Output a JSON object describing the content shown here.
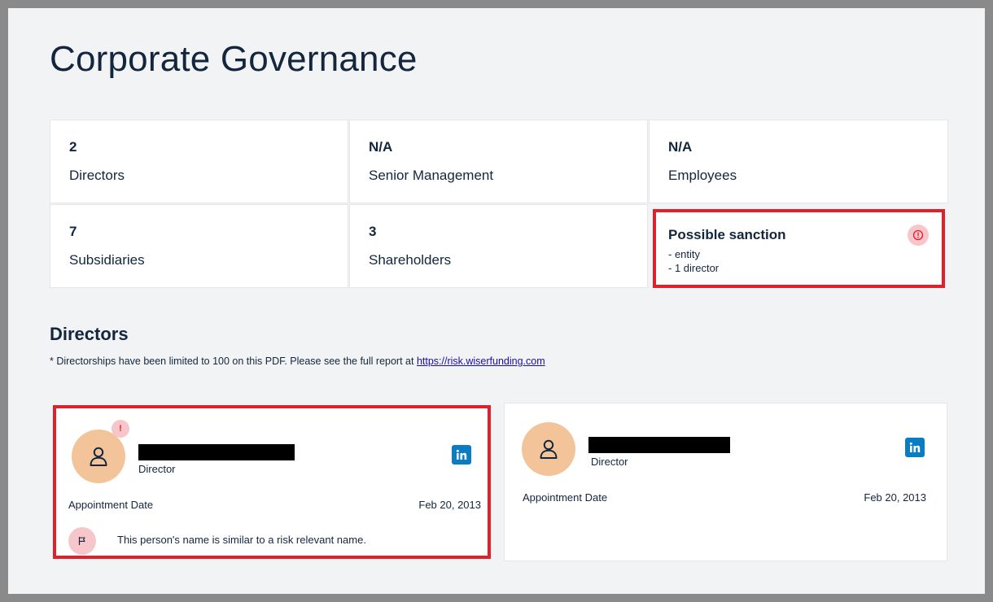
{
  "title": "Corporate Governance",
  "stats": [
    {
      "value": "2",
      "label": "Directors"
    },
    {
      "value": "N/A",
      "label": "Senior Management"
    },
    {
      "value": "N/A",
      "label": "Employees"
    },
    {
      "value": "7",
      "label": "Subsidiaries"
    },
    {
      "value": "3",
      "label": "Shareholders"
    }
  ],
  "sanction": {
    "heading": "Possible sanction",
    "line1": "- entity",
    "line2": "- 1 director",
    "icon": "alert-circle-icon"
  },
  "directors_section": {
    "title": "Directors",
    "note_text": "* Directorships have been limited to 100 on this PDF. Please see the full report at ",
    "note_link": "https://risk.wiserfunding.com"
  },
  "directors": [
    {
      "role": "Director",
      "appointment_label": "Appointment Date",
      "appointment_date": "Feb 20, 2013",
      "badge": "!",
      "flag_message": "This person's name is similar to a risk relevant name."
    },
    {
      "role": "Director",
      "appointment_label": "Appointment Date",
      "appointment_date": "Feb 20, 2013"
    }
  ],
  "colors": {
    "alert_red": "#e0202b",
    "alert_pink": "#f6c6ca",
    "avatar": "#f3c49a",
    "linkedin": "#0a7cc4",
    "text": "#13263d"
  }
}
